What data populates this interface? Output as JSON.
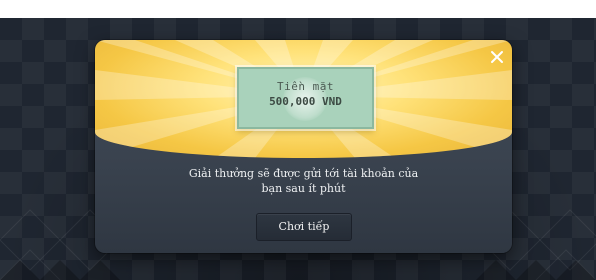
{
  "prize": {
    "label": "Tiền mặt",
    "amount": "500,000 VND"
  },
  "message": {
    "line1": "Giải thưởng sẽ được gửi tới tài khoản của",
    "line2": "bạn sau ít phút"
  },
  "actions": {
    "continue_label": "Chơi tiếp",
    "close_icon": "close-icon"
  },
  "colors": {
    "sunburst": "#f5c745",
    "prize_card": "#a9d2bb",
    "modal_bg": "#3f4956",
    "button_bg": "#2a313c",
    "page_bg": "#1f2631"
  }
}
